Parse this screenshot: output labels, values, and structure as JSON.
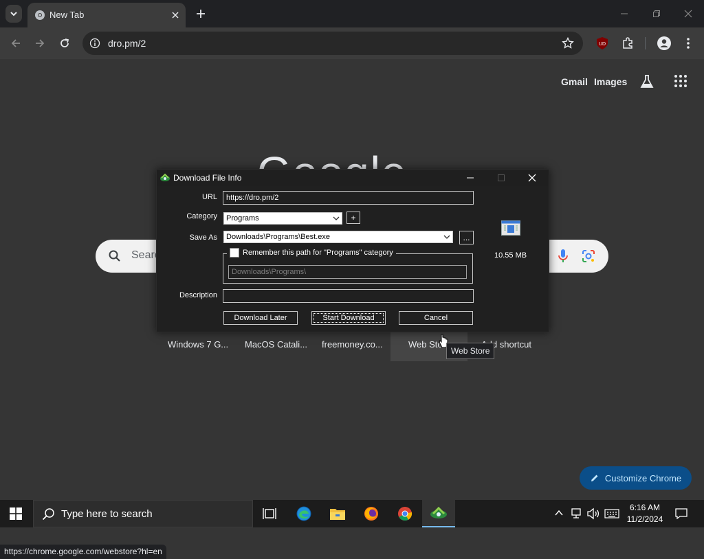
{
  "browser": {
    "tab_title": "New Tab",
    "url": "dro.pm/2",
    "status_url": "https://chrome.google.com/webstore?hl=en"
  },
  "ntp": {
    "links": {
      "gmail": "Gmail",
      "images": "Images"
    },
    "logo": "Google",
    "search_placeholder": "Search Google or type a URL",
    "shortcuts": [
      "Windows 7 G...",
      "MacOS Catali...",
      "freemoney.co...",
      "Web Store",
      "Add shortcut"
    ],
    "tooltip": "Web Store",
    "customize_label": "Customize Chrome"
  },
  "dialog": {
    "title": "Download File Info",
    "url_label": "URL",
    "url_value": "https://dro.pm/2",
    "category_label": "Category",
    "category_value": "Programs",
    "add_button": "+",
    "save_as_label": "Save As",
    "save_as_value": "Downloads\\Programs\\Best.exe",
    "browse_button": "...",
    "remember_label": "Remember this path for \"Programs\" category",
    "remember_path": "Downloads\\Programs\\",
    "description_label": "Description",
    "description_value": "",
    "file_size": "10.55 MB",
    "buttons": {
      "download_later": "Download Later",
      "start_download": "Start Download",
      "cancel": "Cancel"
    }
  },
  "taskbar": {
    "search_placeholder": "Type here to search",
    "time": "6:16 AM",
    "date": "11/2/2024"
  },
  "colors": {
    "page_bg": "#353535",
    "customize_bg": "#0b4e89",
    "taskbar_active": "#76b9ed"
  }
}
